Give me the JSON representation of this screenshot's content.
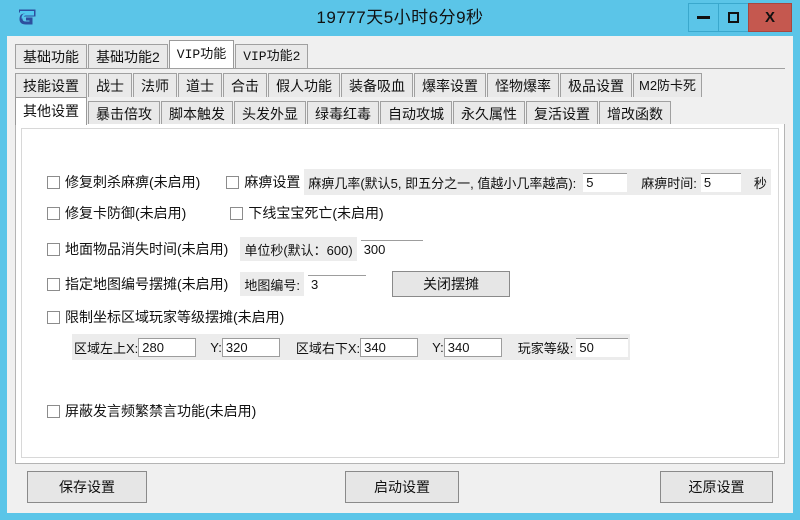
{
  "window": {
    "title": "19777天5小时6分9秒",
    "icon": "app-logo-icon",
    "minimize_label": "",
    "maximize_label": "",
    "close_label": "X",
    "titlebar_color": "#5bc5e8",
    "close_color": "#c5584f"
  },
  "tabs_row1": [
    {
      "label": "基础功能",
      "active": false
    },
    {
      "label": "基础功能2",
      "active": false
    },
    {
      "label": "VIP功能",
      "active": true
    },
    {
      "label": "VIP功能2",
      "active": false
    }
  ],
  "tabs_row2": [
    {
      "label": "技能设置",
      "active": false
    },
    {
      "label": "战士",
      "active": false
    },
    {
      "label": "法师",
      "active": false
    },
    {
      "label": "道士",
      "active": false
    },
    {
      "label": "合击",
      "active": false
    },
    {
      "label": "假人功能",
      "active": false
    },
    {
      "label": "装备吸血",
      "active": false
    },
    {
      "label": "爆率设置",
      "active": false
    },
    {
      "label": "怪物爆率",
      "active": false
    },
    {
      "label": "极品设置",
      "active": false
    },
    {
      "label": "M2防卡死",
      "active": false
    }
  ],
  "tabs_row3": [
    {
      "label": "其他设置",
      "active": true
    },
    {
      "label": "暴击倍攻",
      "active": false
    },
    {
      "label": "脚本触发",
      "active": false
    },
    {
      "label": "头发外显",
      "active": false
    },
    {
      "label": "绿毒红毒",
      "active": false
    },
    {
      "label": "自动攻城",
      "active": false
    },
    {
      "label": "永久属性",
      "active": false
    },
    {
      "label": "复活设置",
      "active": false
    },
    {
      "label": "增改函数",
      "active": false
    }
  ],
  "form": {
    "fix_assassinate_paralysis": "修复刺杀麻痹(未启用)",
    "paralysis_settings": "麻痹设置",
    "paralysis_rate_label": "麻痹几率(默认5, 即五分之一, 值越小几率越高):",
    "paralysis_rate_value": "5",
    "paralysis_time_label": "麻痹时间:",
    "paralysis_time_value": "5",
    "paralysis_time_unit": "秒",
    "fix_card_defense": "修复卡防御(未启用)",
    "offline_pet_death": "下线宝宝死亡(未启用)",
    "ground_item_disappear": "地面物品消失时间(未启用)",
    "unit_second_label": "单位秒(默认：600)",
    "unit_second_value": "300",
    "designate_map_stall": "指定地图编号摆摊(未启用)",
    "map_number_label": "地图编号:",
    "map_number_value": "3",
    "close_stall_button": "关闭摆摊",
    "limit_coord_area": "限制坐标区域玩家等级摆摊(未启用)",
    "area_topleft_label": "区域左上X:",
    "area_topleft_x": "280",
    "area_topleft_y_label": "Y:",
    "area_topleft_y": "320",
    "area_bottomright_label": "区域右下X:",
    "area_bottomright_x": "340",
    "area_bottomright_y_label": "Y:",
    "area_bottomright_y": "340",
    "player_level_label": "玩家等级:",
    "player_level_value": "50",
    "block_frequent_speech": "屏蔽发言频繁禁言功能(未启用)"
  },
  "bottom": {
    "save": "保存设置",
    "start": "启动设置",
    "restore": "还原设置"
  }
}
